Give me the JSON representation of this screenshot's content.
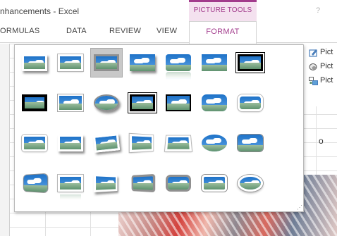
{
  "window": {
    "title": "nhancements - Excel",
    "controls": "?"
  },
  "contextual_group": {
    "label": "PICTURE TOOLS",
    "accent": "#a23b8c"
  },
  "tabs": {
    "formulas": "ORMULAS",
    "data": "DATA",
    "review": "REVIEW",
    "view": "VIEW",
    "format": "FORMAT"
  },
  "ribbon_right": {
    "items": [
      {
        "label": "Pict",
        "icon": "picture-border-icon"
      },
      {
        "label": "Pict",
        "icon": "picture-effects-icon"
      },
      {
        "label": "Pict",
        "icon": "picture-layout-icon"
      }
    ]
  },
  "sheet": {
    "cell_text": "o"
  },
  "gallery": {
    "name": "Picture Styles",
    "rows": 4,
    "columns": 8,
    "selected_index": 2,
    "styles": [
      "simple-frame-white",
      "beveled-matte-white",
      "metal-frame",
      "drop-shadow-rectangle",
      "reflected-rounded-rectangle",
      "soft-edge-rectangle",
      "double-frame-black",
      "thick-matte-black",
      "simple-frame-black",
      "center-shadow-rectangle",
      "soft-edge-oval",
      "compound-frame-black",
      "moderate-frame-black",
      "rounded-diagonal-corner-white",
      "rounded-rectangle-white",
      "snip-diagonal-corner-white",
      "simple-frame-white-2",
      "perspective-shadow-white",
      "rotated-white",
      "beveled-white",
      "relaxed-perspective-white",
      "soft-edge-oval-2",
      "bevel-rectangle",
      "bevel-perspective",
      "reflected-bevel-white",
      "bevel-perspective-left-white",
      "reflected-perspective-right",
      "metal-rounded-rectangle",
      "metal-rounded",
      "moderate-frame-white",
      "bevel-rounded",
      "metal-oval"
    ]
  }
}
